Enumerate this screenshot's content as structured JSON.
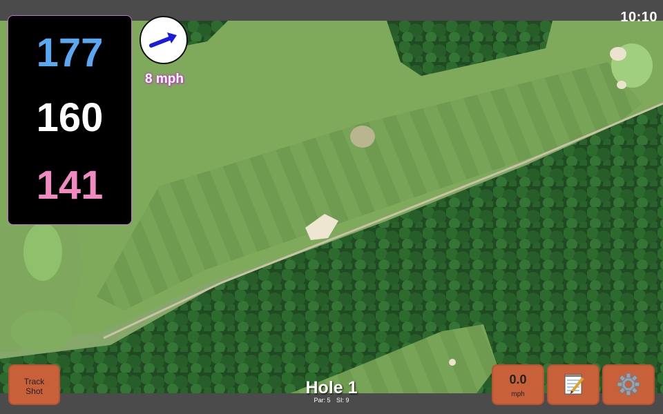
{
  "status": {
    "time": "10:10"
  },
  "yardages": {
    "back": "177",
    "middle": "160",
    "front": "141"
  },
  "wind": {
    "speed_text": "8 mph",
    "icon": "wind-arrow-icon"
  },
  "hole": {
    "title": "Hole 1",
    "par_text": "Par: 5",
    "si_text": "SI: 9"
  },
  "buttons": {
    "track_shot": {
      "line1": "Track",
      "line2": "Shot"
    },
    "speed": {
      "value": "0.0",
      "unit": "mph"
    },
    "notes": {
      "icon": "notepad-icon"
    },
    "settings": {
      "icon": "gear-icon"
    }
  },
  "colors": {
    "back_yardage": "#5aa8f2",
    "middle_yardage": "#ffffff",
    "front_yardage": "#f08ac0",
    "button": "#c8603a",
    "wind_arrow": "#1a1ae0"
  }
}
